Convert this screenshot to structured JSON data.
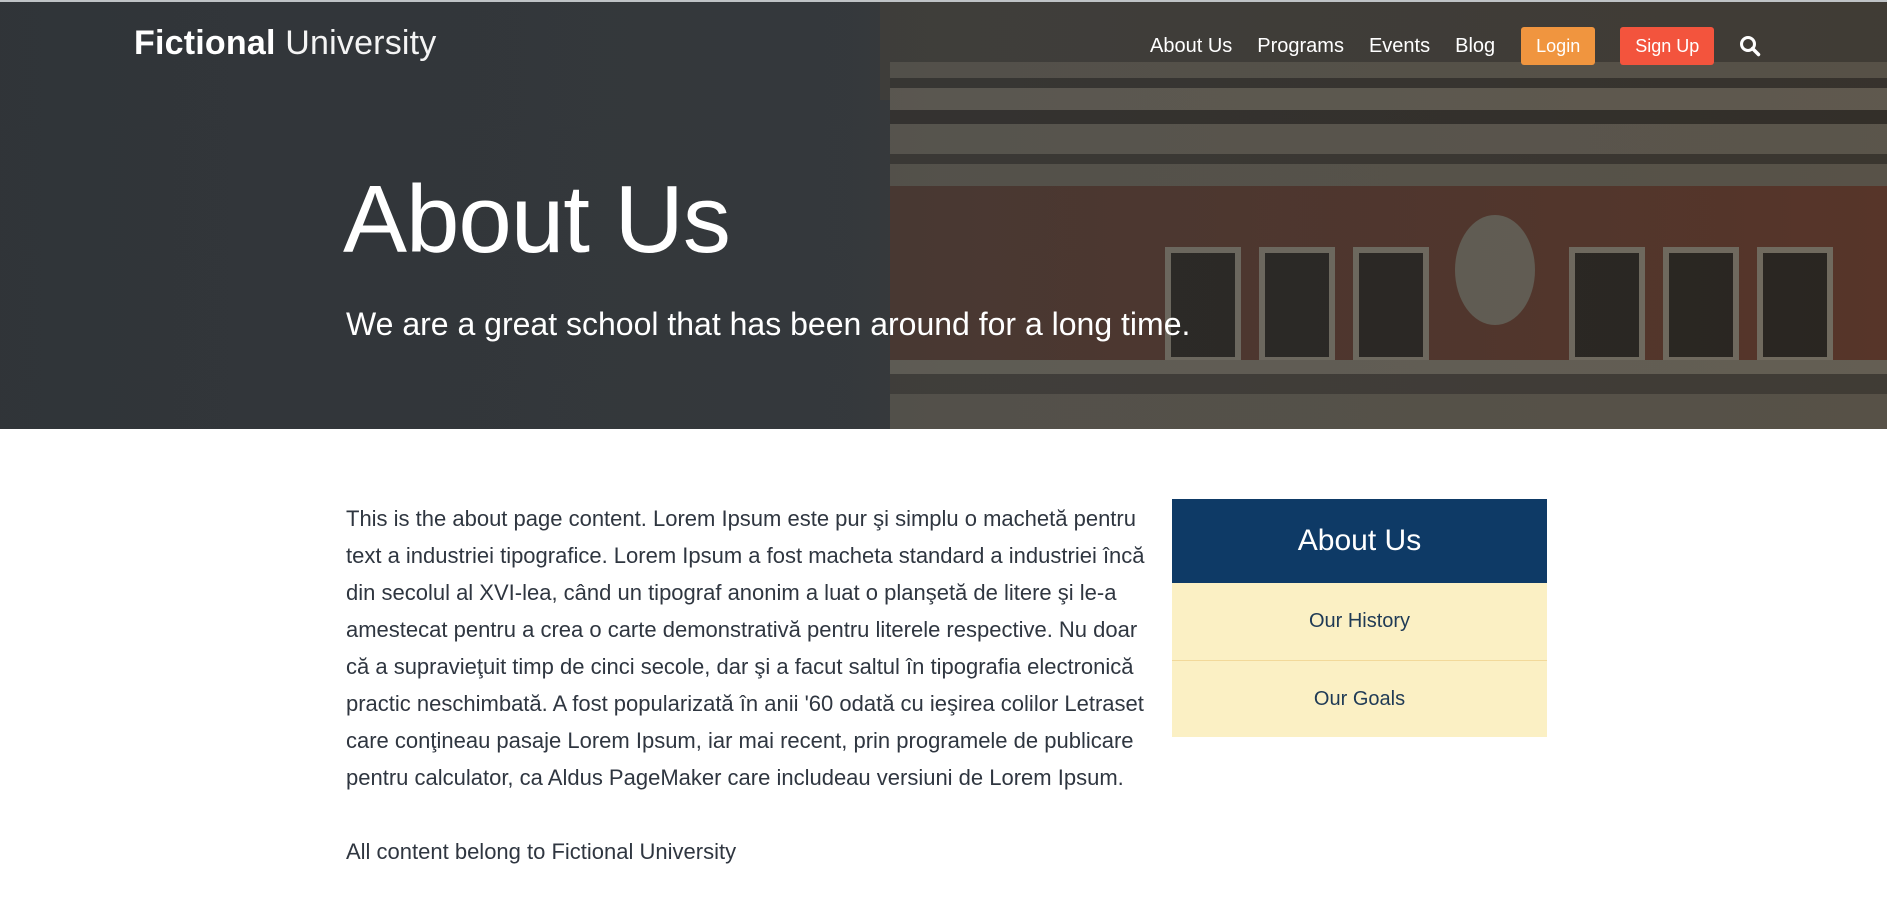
{
  "header": {
    "logo_bold": "Fictional",
    "logo_light": "University",
    "nav": [
      {
        "label": "About Us"
      },
      {
        "label": "Programs"
      },
      {
        "label": "Events"
      },
      {
        "label": "Blog"
      }
    ],
    "login_label": "Login",
    "signup_label": "Sign Up",
    "search_icon": "search-icon"
  },
  "hero": {
    "title": "About Us",
    "subtitle": "We are a great school that has been around for a long time."
  },
  "main": {
    "paragraphs": [
      "This is the about page content. Lorem Ipsum este pur şi simplu o machetă pentru text a industriei tipografice. Lorem Ipsum a fost macheta standard a industriei încă din secolul al XVI-lea, când un tipograf anonim a luat o planşetă de litere şi le-a amestecat pentru a crea o carte demonstrativă pentru literele respective. Nu doar că a supravieţuit timp de cinci secole, dar şi a facut saltul în tipografia electronică practic neschimbată. A fost popularizată în anii '60 odată cu ieşirea colilor Letraset care conţineau pasaje Lorem Ipsum, iar mai recent, prin programele de publicare pentru calculator, ca Aldus PageMaker care includeau versiuni de Lorem Ipsum.",
      "All content belong to Fictional University"
    ]
  },
  "sidebar": {
    "title": "About Us",
    "items": [
      {
        "label": "Our History"
      },
      {
        "label": "Our Goals"
      }
    ]
  },
  "colors": {
    "login": "#f0953f",
    "signup": "#f3543d",
    "sidebar_header": "#0e3a66",
    "sidebar_item_bg": "#fbf0c4"
  }
}
